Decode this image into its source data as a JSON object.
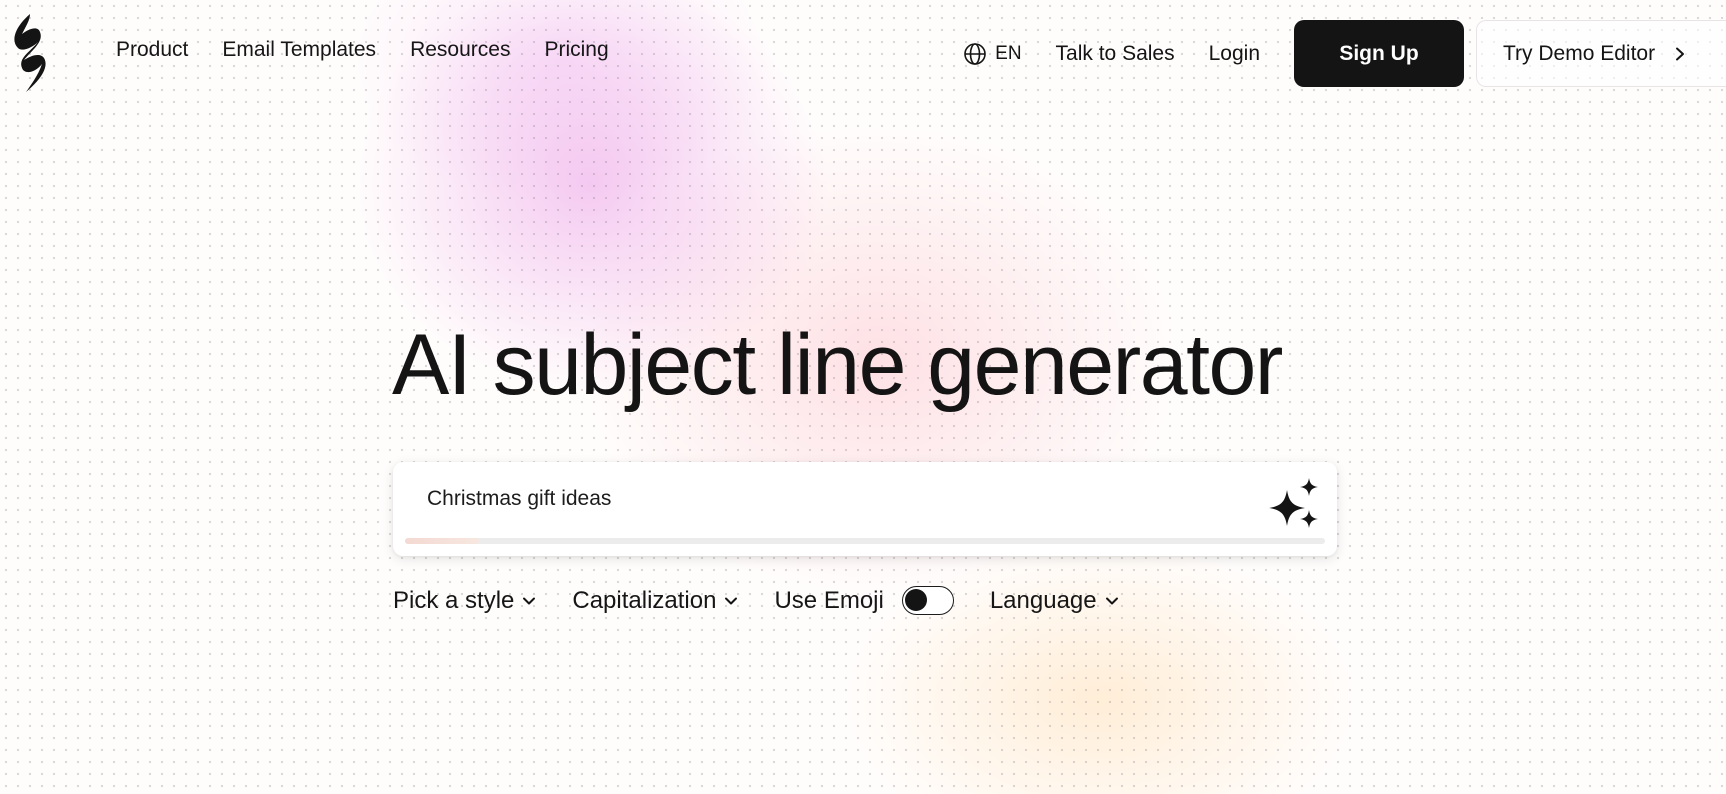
{
  "nav": {
    "links": [
      "Product",
      "Email Templates",
      "Resources",
      "Pricing"
    ],
    "language": "EN",
    "talk_to_sales": "Talk to Sales",
    "login": "Login",
    "sign_up": "Sign Up",
    "try_demo": "Try Demo Editor"
  },
  "hero": {
    "title": "AI subject line generator",
    "prompt_value": "Christmas gift ideas",
    "progress": 0.08
  },
  "controls": {
    "style": "Pick a style",
    "capitalization": "Capitalization",
    "emoji": "Use Emoji",
    "emoji_enabled": false,
    "language": "Language"
  },
  "colors": {
    "primary": "#141414",
    "background": "#fffdfc",
    "accent_pink": "#eca0e8",
    "accent_peach": "#fcbec8",
    "accent_yellow": "#ffd6a0"
  },
  "icons": {
    "logo": "brand-logo-icon",
    "language": "globe-icon",
    "demo": "chevron-right-icon",
    "generate": "sparkle-icon",
    "dropdown": "chevron-down-icon"
  }
}
